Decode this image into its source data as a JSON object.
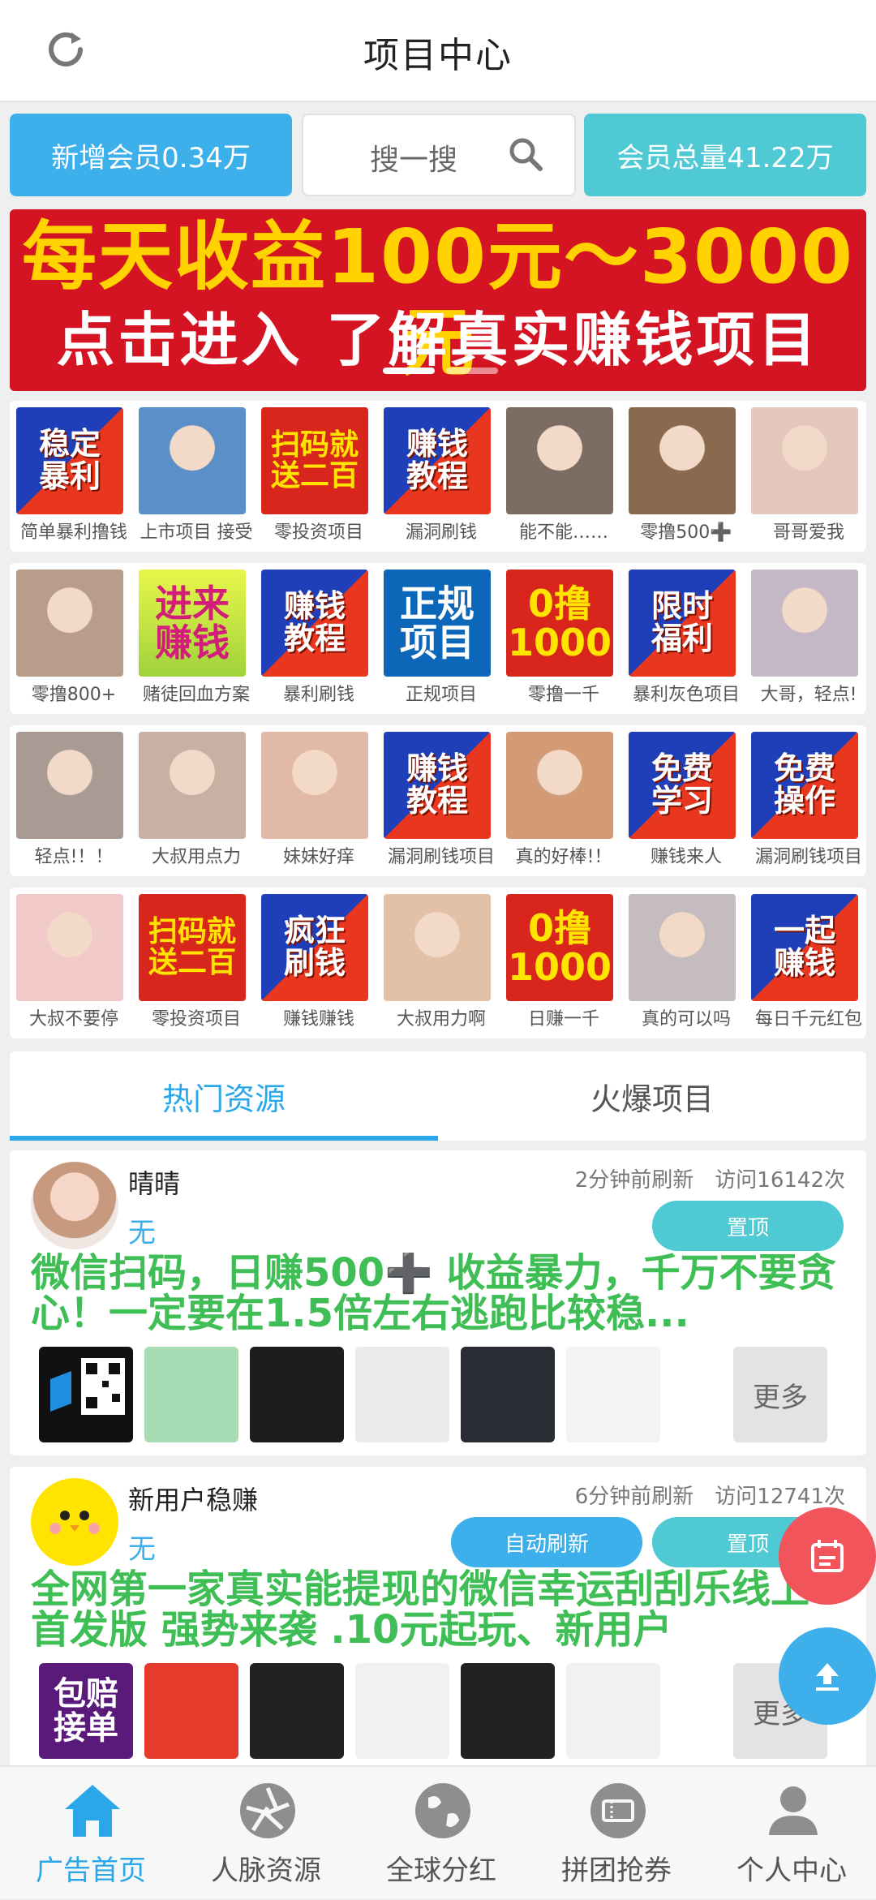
{
  "header": {
    "title": "项目中心",
    "refresh_icon": "refresh-icon"
  },
  "topbar": {
    "new_members": "新增会员0.34万",
    "search_placeholder": "搜一搜",
    "total_members": "会员总量41.22万"
  },
  "banner": {
    "line1": "每天收益100元～3000元",
    "line2": "点击进入 了解真实赚钱项目",
    "slides": 3,
    "active": 1
  },
  "grid": [
    [
      {
        "label": "简单暴利撸钱",
        "text": "稳定\n暴利",
        "style": "ban"
      },
      {
        "label": "上市项目 接受",
        "text": "",
        "style": "photo",
        "color": "#5b8fc7"
      },
      {
        "label": "零投资项目",
        "text": "扫码就\n送二百",
        "style": "red"
      },
      {
        "label": "漏洞刷钱",
        "text": "赚钱\n教程",
        "style": "ban"
      },
      {
        "label": "能不能……",
        "text": "",
        "style": "photo",
        "color": "#7b6d63"
      },
      {
        "label": "零撸500➕",
        "text": "",
        "style": "photo",
        "color": "#8a6a4e"
      },
      {
        "label": "哥哥爱我",
        "text": "",
        "style": "photo",
        "color": "#e4c8bd"
      }
    ],
    [
      {
        "label": "零撸800+",
        "text": "",
        "style": "photo",
        "color": "#b89d8a"
      },
      {
        "label": "赌徒回血方案",
        "text": "进来\n赚钱",
        "style": "green"
      },
      {
        "label": "暴利刷钱",
        "text": "赚钱\n教程",
        "style": "ban"
      },
      {
        "label": "正规项目",
        "text": "正规\n项目",
        "style": "blue"
      },
      {
        "label": "零撸一千",
        "text": "0撸\n1000",
        "style": "red0"
      },
      {
        "label": "暴利灰色项目",
        "text": "限时\n福利",
        "style": "ban"
      },
      {
        "label": "大哥，轻点!",
        "text": "",
        "style": "photo",
        "color": "#c4b7c6"
      }
    ],
    [
      {
        "label": "轻点!！！",
        "text": "",
        "style": "photo",
        "color": "#a99b94"
      },
      {
        "label": "大叔用点力",
        "text": "",
        "style": "photo",
        "color": "#c9b0a3"
      },
      {
        "label": "妹妹好痒",
        "text": "",
        "style": "photo",
        "color": "#e2b9a6"
      },
      {
        "label": "漏洞刷钱项目",
        "text": "赚钱\n教程",
        "style": "ban"
      },
      {
        "label": "真的好棒!！",
        "text": "",
        "style": "photo",
        "color": "#d29b76"
      },
      {
        "label": "赚钱来人",
        "text": "免费\n学习",
        "style": "ban"
      },
      {
        "label": "漏洞刷钱项目",
        "text": "免费\n操作",
        "style": "ban"
      }
    ],
    [
      {
        "label": "大叔不要停",
        "text": "",
        "style": "photo",
        "color": "#f2c9c9"
      },
      {
        "label": "零投资项目",
        "text": "扫码就\n送二百",
        "style": "red"
      },
      {
        "label": "赚钱赚钱",
        "text": "疯狂\n刷钱",
        "style": "ban"
      },
      {
        "label": "大叔用力啊",
        "text": "",
        "style": "photo",
        "color": "#e3c1a6"
      },
      {
        "label": "日赚一千",
        "text": "0撸\n1000",
        "style": "red0"
      },
      {
        "label": "真的可以吗",
        "text": "",
        "style": "photo",
        "color": "#c5bcc0"
      },
      {
        "label": "每日千元红包",
        "text": "一起\n赚钱",
        "style": "ban"
      }
    ]
  ],
  "tabs": {
    "hot": "热门资源",
    "fire": "火爆项目"
  },
  "posts": [
    {
      "name": "晴晴",
      "sub": "无",
      "time": "2分钟前刷新",
      "visits": "访问16142次",
      "pin": "置顶",
      "text": "微信扫码，日赚500➕ 收益暴力，千万不要贪心！一定要在1.5倍左右逃跑比较稳...",
      "more": "更多"
    },
    {
      "name": "新用户稳赚",
      "sub": "无",
      "time": "6分钟前刷新",
      "visits": "访问12741次",
      "auto": "自动刷新",
      "pin": "置顶",
      "text": "全网第一家真实能提现的微信幸运刮刮乐线上首发版 强势来袭 .10元起玩、新用户",
      "more": "更多",
      "thumb_text": "包赔\n接单"
    }
  ],
  "fabs": {
    "calendar": "calendar-icon",
    "upload": "upload-icon"
  },
  "bottom_nav": [
    {
      "label": "广告首页",
      "icon": "home-icon"
    },
    {
      "label": "人脉资源",
      "icon": "aperture-icon"
    },
    {
      "label": "全球分红",
      "icon": "globe-icon"
    },
    {
      "label": "拼团抢券",
      "icon": "ticket-icon"
    },
    {
      "label": "个人中心",
      "icon": "user-icon"
    }
  ],
  "colors": {
    "accent": "#2aa7e8",
    "green_text": "#3fbe55",
    "fab_red": "#f2545b",
    "fab_blue": "#3db0ec"
  }
}
